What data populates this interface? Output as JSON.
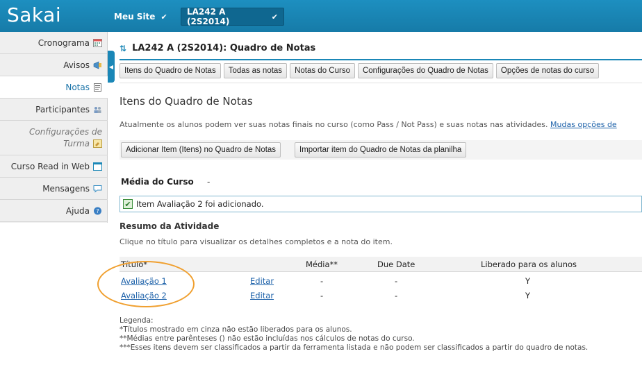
{
  "header": {
    "logo": "Sakai",
    "site_menu": "Meu Site",
    "course_menu": "LA242 A (2S2014)"
  },
  "sidebar": {
    "items": [
      {
        "label": "Cronograma",
        "icon": "calendar-icon"
      },
      {
        "label": "Avisos",
        "icon": "megaphone-icon"
      },
      {
        "label": "Notas",
        "icon": "gradebook-icon"
      },
      {
        "label": "Participantes",
        "icon": "people-icon"
      },
      {
        "label_line1": "Configurações de",
        "label_line2": "Turma",
        "icon": "settings-icon"
      },
      {
        "label": "Curso Read in Web",
        "icon": "window-icon"
      },
      {
        "label": "Mensagens",
        "icon": "speech-bubble-icon"
      },
      {
        "label": "Ajuda",
        "icon": "help-icon"
      }
    ]
  },
  "main": {
    "page_title": "LA242 A (2S2014): Quadro de Notas",
    "tabs": [
      "Itens do Quadro de Notas",
      "Todas as notas",
      "Notas do Curso",
      "Configurações do Quadro de Notas",
      "Opções de notas do curso"
    ],
    "section_heading": "Itens do Quadro de Notas",
    "notice_text": "Atualmente os alunos podem ver suas notas finais no curso (como Pass / Not Pass) e suas notas nas atividades.",
    "notice_link": "Mudas opções de",
    "actions": [
      "Adicionar Item (Itens) no Quadro de Notas",
      "Importar item do Quadro de Notas da planilha"
    ],
    "course_average_label": "Média do Curso",
    "course_average_value": "-",
    "success_message": "Item Avaliação 2 foi adicionado.",
    "summary_heading": "Resumo da Atividade",
    "summary_subtitle": "Clique no título para visualizar os detalhes completos e a nota do item.",
    "table": {
      "columns": [
        "Título*",
        "Média**",
        "Due Date",
        "Liberado para os alunos"
      ],
      "rows": [
        {
          "title": "Avaliação 1",
          "edit": "Editar",
          "average": "-",
          "due": "-",
          "released": "Y"
        },
        {
          "title": "Avaliação 2",
          "edit": "Editar",
          "average": "-",
          "due": "-",
          "released": "Y"
        }
      ]
    },
    "legend": [
      "Legenda:",
      "*Títulos mostrado em cinza não estão liberados para os alunos.",
      "**Médias entre parênteses () não estão incluídas nos cálculos de notas do curso.",
      "***Esses itens devem ser classificados a partir da ferramenta listada e não podem ser classificados a partir do quadro de notas."
    ]
  },
  "colors": {
    "brand_blue": "#1a87b7",
    "highlight_orange": "#f0a030",
    "link_blue": "#1a5fa8"
  }
}
